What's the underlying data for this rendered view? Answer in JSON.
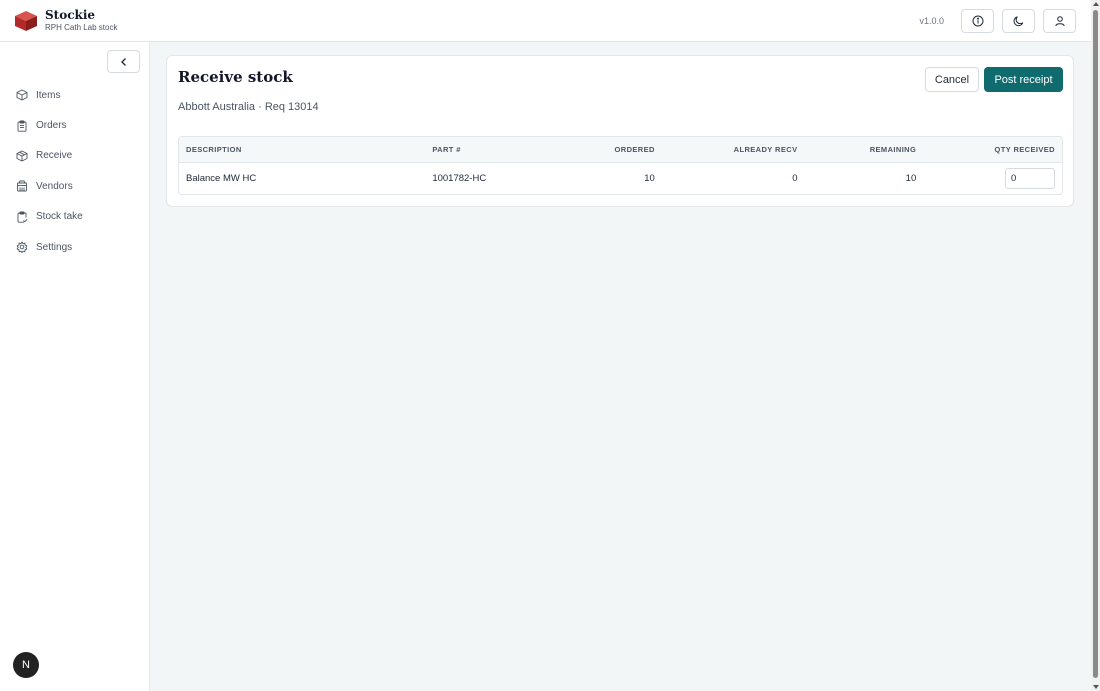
{
  "app": {
    "name": "Stockie",
    "subtitle": "RPH Cath Lab stock",
    "version": "v1.0.0",
    "avatar_letter": "N"
  },
  "header": {
    "icons": [
      "info-icon",
      "moon-icon",
      "user-icon"
    ]
  },
  "sidebar": {
    "items": [
      {
        "label": "Items",
        "icon": "box-icon"
      },
      {
        "label": "Orders",
        "icon": "clipboard-icon"
      },
      {
        "label": "Receive",
        "icon": "package-icon"
      },
      {
        "label": "Vendors",
        "icon": "building-icon"
      },
      {
        "label": "Stock take",
        "icon": "clipboard-check-icon"
      },
      {
        "label": "Settings",
        "icon": "gear-icon"
      }
    ]
  },
  "main": {
    "title": "Receive stock",
    "subtitle": "Abbott Australia · Req 13014",
    "cancel_label": "Cancel",
    "post_label": "Post receipt",
    "table": {
      "columns": [
        "DESCRIPTION",
        "PART #",
        "ORDERED",
        "ALREADY RECV",
        "REMAINING",
        "QTY RECEIVED"
      ],
      "rows": [
        {
          "description": "Balance MW HC",
          "part": "1001782-HC",
          "ordered": "10",
          "already_recv": "0",
          "remaining": "10",
          "qty_received": "0"
        }
      ]
    }
  },
  "colors": {
    "accent": "#0f6b6e",
    "background": "#f3f6f7"
  }
}
